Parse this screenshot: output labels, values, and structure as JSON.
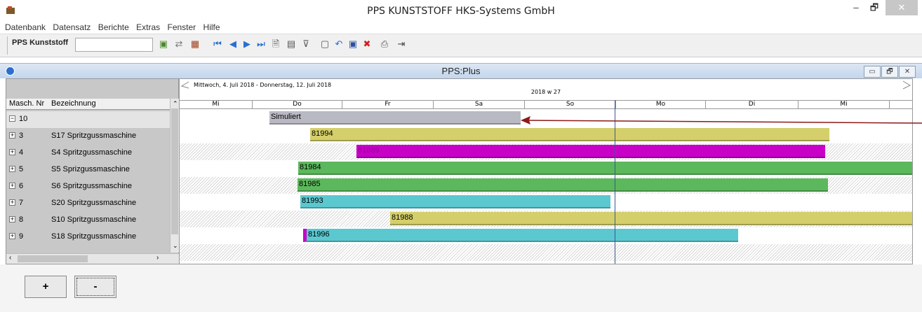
{
  "window": {
    "title": "PPS KUNSTSTOFF HKS-Systems GmbH",
    "minimize": "–",
    "maximize": "🗗",
    "close": "✕"
  },
  "menu": [
    "Datenbank",
    "Datensatz",
    "Berichte",
    "Extras",
    "Fenster",
    "Hilfe"
  ],
  "toolbar": {
    "label": "PPS Kunststoff",
    "input_value": ""
  },
  "mdi": {
    "title": "PPS:Plus"
  },
  "table": {
    "col_nr": "Masch. Nr",
    "col_bez": "Bezeichnung",
    "group": {
      "nr": "10",
      "expander": "−"
    },
    "rows": [
      {
        "nr": "3",
        "bez": "S17 Spritzgussmaschine"
      },
      {
        "nr": "4",
        "bez": "S4 Spritzgussmaschine"
      },
      {
        "nr": "5",
        "bez": "S5 Sprizgussmaschine"
      },
      {
        "nr": "6",
        "bez": "S6 Spritzgussmaschine"
      },
      {
        "nr": "7",
        "bez": "S20 Spritzgussmaschine"
      },
      {
        "nr": "8",
        "bez": "S10 Spritzgussmaschine"
      },
      {
        "nr": "9",
        "bez": "S18 Spritzgussmaschine"
      }
    ]
  },
  "gantt": {
    "range": "Mittwoch, 4. Juli 2018 - Donnerstag, 12. Juli 2018",
    "week": "2018 w 27",
    "days": [
      "Mi",
      "Do",
      "Fr",
      "Sa",
      "So",
      "Mo",
      "Di",
      "Mi"
    ],
    "simulated_label": "Simuliert",
    "bars": [
      {
        "label": "81994",
        "color": "#d4cf6a"
      },
      {
        "label": "81889",
        "color": "#c800c8"
      },
      {
        "label": "81984",
        "color": "#5cb85c"
      },
      {
        "label": "81985",
        "color": "#5cb85c"
      },
      {
        "label": "81993",
        "color": "#5bc8d0"
      },
      {
        "label": "81988",
        "color": "#d4cf6a"
      },
      {
        "label": "81996",
        "color": "#5bc8d0"
      }
    ]
  },
  "buttons": {
    "plus": "+",
    "minus": "-"
  }
}
